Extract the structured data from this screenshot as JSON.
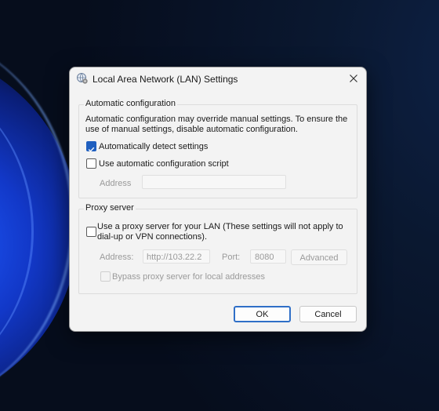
{
  "dialog": {
    "title": "Local Area Network (LAN) Settings",
    "close_icon": "close-icon",
    "app_icon": "network-settings-icon"
  },
  "auto_config": {
    "legend": "Automatic configuration",
    "description_line1": "Automatic configuration may override manual settings.  To ensure the",
    "description_line2": "use of manual settings, disable automatic configuration.",
    "detect_label": "Automatically detect settings",
    "detect_checked": true,
    "script_label": "Use automatic configuration script",
    "script_checked": false,
    "address_label": "Address",
    "address_value": ""
  },
  "proxy": {
    "legend": "Proxy server",
    "use_proxy_line1": "Use a proxy server for your LAN (These settings will not apply to",
    "use_proxy_line2": "dial-up or VPN connections).",
    "use_proxy_checked": false,
    "address_label": "Address:",
    "address_value": "http://103.22.2",
    "port_label": "Port:",
    "port_value": "8080",
    "advanced_label": "Advanced",
    "bypass_label": "Bypass proxy server for local addresses",
    "bypass_checked": false
  },
  "buttons": {
    "ok": "OK",
    "cancel": "Cancel"
  },
  "colors": {
    "accent": "#1f5fbf",
    "ok_border": "#2f6fc7"
  }
}
